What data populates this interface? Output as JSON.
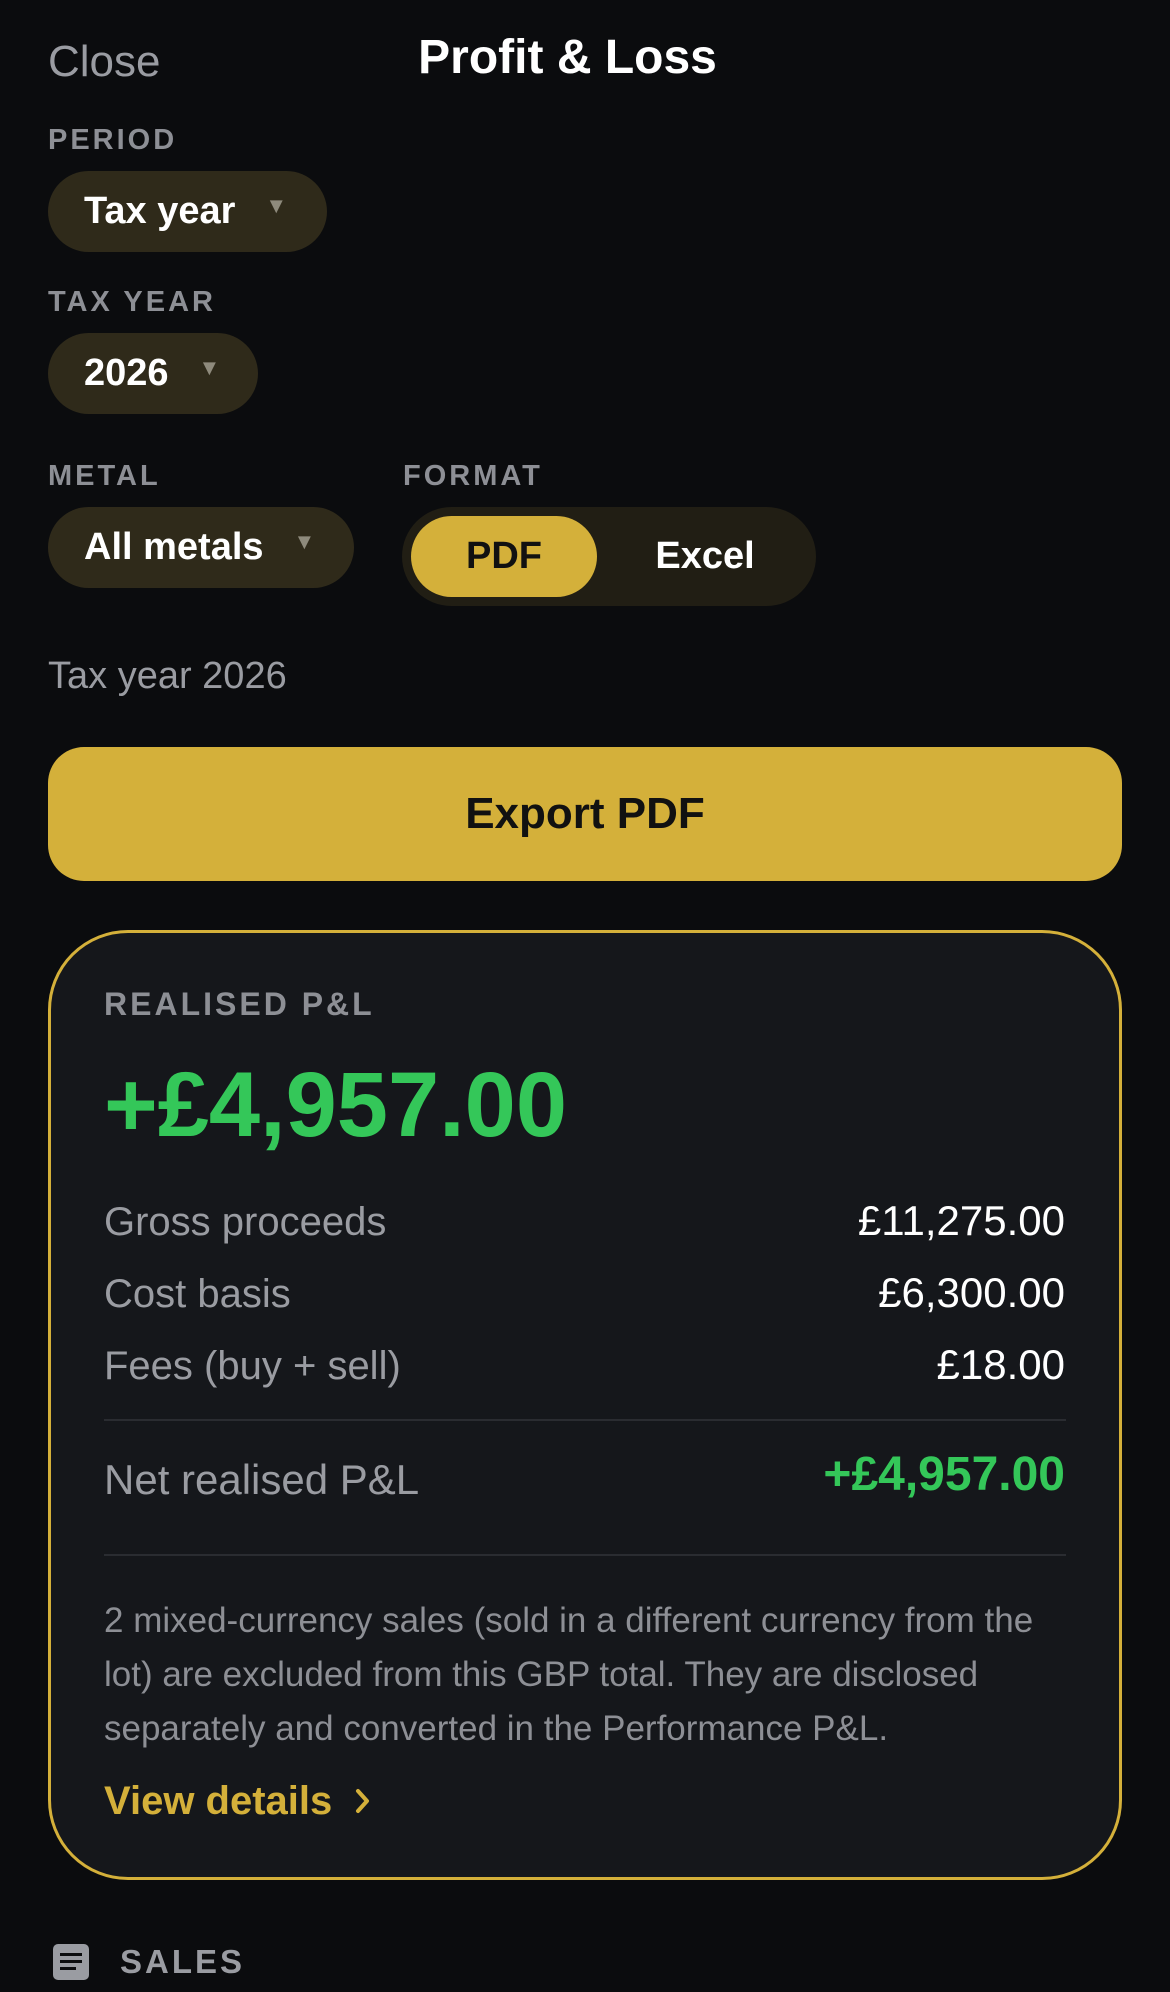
{
  "header": {
    "close_label": "Close",
    "title": "Profit & Loss"
  },
  "filters": {
    "period": {
      "label": "PERIOD",
      "value": "Tax year"
    },
    "tax_year": {
      "label": "TAX YEAR",
      "value": "2026"
    },
    "metal": {
      "label": "METAL",
      "value": "All metals"
    },
    "format": {
      "label": "FORMAT",
      "options": [
        "PDF",
        "Excel"
      ],
      "selected": "PDF"
    }
  },
  "period_summary": "Tax year 2026",
  "export_button_label": "Export PDF",
  "realised_card": {
    "label": "REALISED P&L",
    "total": "+£4,957.00",
    "rows": [
      {
        "label": "Gross proceeds",
        "value": "£11,275.00"
      },
      {
        "label": "Cost basis",
        "value": "£6,300.00"
      },
      {
        "label": "Fees (buy + sell)",
        "value": "£18.00"
      }
    ],
    "net_label": "Net realised P&L",
    "net_value": "+£4,957.00",
    "note": "2 mixed-currency sales (sold in a different currency from the lot) are excluded from this GBP total. They are disclosed separately and converted in the Performance P&L.",
    "view_details_label": "View details"
  },
  "sales_section": {
    "label": "SALES",
    "icon": "list-document-icon"
  },
  "colors": {
    "background": "#0b0c0e",
    "accent_gold": "#d4b03a",
    "positive_green": "#34c759",
    "card_background": "#15171b",
    "pill_background": "#2f2a1a",
    "muted_text": "#9a9ca2"
  }
}
